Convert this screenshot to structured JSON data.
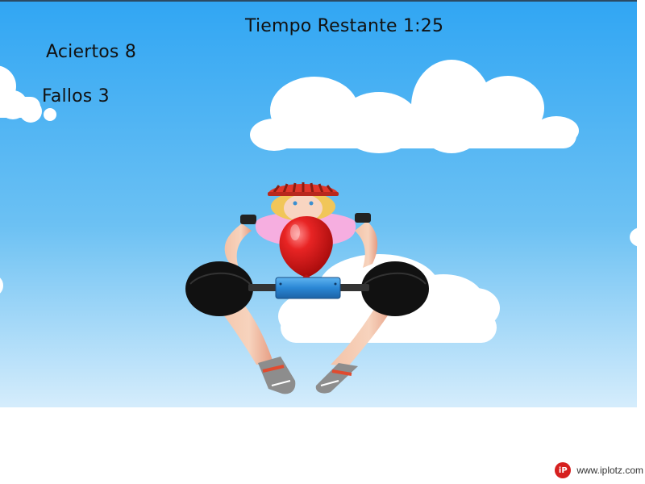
{
  "hud": {
    "time_label": "Tiempo Restante",
    "time_value": "1:25",
    "hits_label": "Aciertos",
    "hits_value": "8",
    "misses_label": "Fallos",
    "misses_value": "3"
  },
  "watermark": {
    "text": "www.iplotz.com",
    "logo_icon": "iplotz-logo"
  },
  "colors": {
    "sky_top": "#38a9f2",
    "sky_bottom": "#cfe9fb",
    "balloon": "#e41b1b",
    "pump": "#2f86d1",
    "helmet": "#e0362a",
    "shirt": "#f6aee0"
  }
}
